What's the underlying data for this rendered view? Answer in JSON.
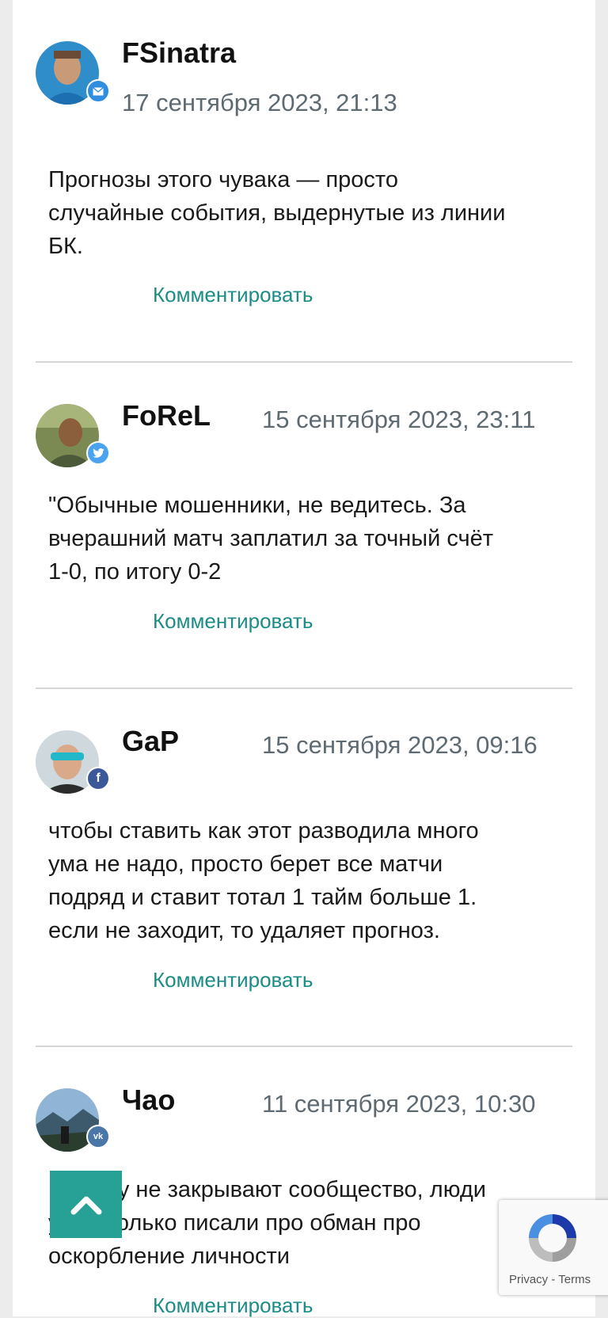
{
  "comments": [
    {
      "author": "FSinatra",
      "date": "17 сентября 2023, 21:13",
      "text_lines": [
        "Прогнозы этого чувака — просто",
        "случайные события, выдернутые из линии",
        "БК."
      ],
      "reply_label": "Комментировать",
      "badge": "mail-icon",
      "badge_color": "#2f8ee0"
    },
    {
      "author": "FoReL",
      "date": "15 сентября 2023, 23:11",
      "text_lines": [
        "\"Обычные мошенники, не ведитесь. За",
        "вчерашний матч заплатил за точный счёт",
        "1-0, по итогу 0-2"
      ],
      "reply_label": "Комментировать",
      "badge": "twitter-icon",
      "badge_color": "#4aa3ee"
    },
    {
      "author": "GaP",
      "date": "15 сентября 2023, 09:16",
      "text_lines": [
        "чтобы ставить как этот разводила много",
        "ума не надо, просто берет все матчи",
        "подряд и ставит тотал 1 тайм больше 1.",
        "если не заходит, то удаляет прогноз."
      ],
      "reply_label": "Комментировать",
      "badge": "facebook-icon",
      "badge_color": "#3b5998"
    },
    {
      "author": "Чао",
      "date": "11 сентября 2023, 10:30",
      "text_lines": [
        "Почему не закрывают сообщество, люди",
        "уже столько писали про обман про",
        "оскорбление личности"
      ],
      "reply_label": "Комментировать",
      "badge": "vk-icon",
      "badge_color": "#4a76a8"
    }
  ],
  "recaptcha": {
    "privacy": "Privacy",
    "separator": " - ",
    "terms": "Terms"
  },
  "scroll_top_icon": "chevron-up-icon",
  "colors": {
    "accent": "#27a096",
    "link": "#1c8c86",
    "date": "#5e6a72"
  }
}
